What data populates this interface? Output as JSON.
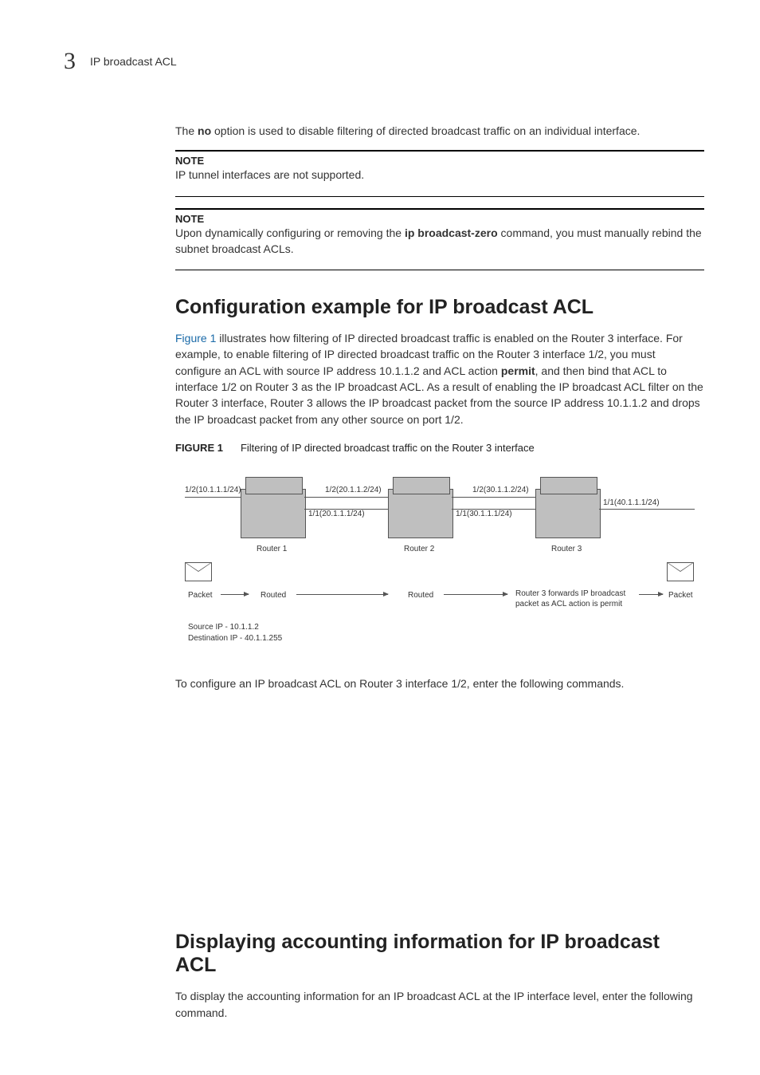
{
  "header": {
    "chapter_number": "3",
    "chapter_title": "IP broadcast ACL"
  },
  "intro": {
    "text_before": "The ",
    "bold_cmd": "no",
    "text_after": " option is used to disable filtering of directed broadcast traffic on an individual interface."
  },
  "note1": {
    "label": "NOTE",
    "text": "IP tunnel interfaces are not supported."
  },
  "note2": {
    "label": "NOTE",
    "text_before": "Upon dynamically configuring or removing the ",
    "bold_cmd": "ip broadcast-zero",
    "text_after": " command, you must manually rebind the subnet broadcast ACLs."
  },
  "section1": {
    "heading": "Configuration example for IP broadcast ACL",
    "para": {
      "link": "Figure 1",
      "text_mid1": " illustrates how filtering of IP directed broadcast traffic is enabled on the Router 3 interface. For example, to enable filtering of IP directed broadcast traffic on the Router 3 interface 1/2, you must configure an ACL with source IP address 10.1.1.2 and ACL action ",
      "bold_cmd": "permit",
      "text_mid2": ", and then bind that ACL to interface 1/2 on Router 3 as the IP broadcast ACL. As a result of enabling the IP broadcast ACL filter on the Router 3 interface, Router 3 allows the IP broadcast packet from the source IP address 10.1.1.2 and drops the IP broadcast packet from any other source on port 1/2."
    },
    "figure": {
      "label": "FIGURE 1",
      "caption": "Filtering of IP directed broadcast traffic on the Router 3 interface",
      "routers": [
        "Router 1",
        "Router 2",
        "Router 3"
      ],
      "ports": {
        "r1_left": "1/2(10.1.1.1/24)",
        "r1_right_top": "1/2(20.1.1.2/24)",
        "r1_right_bot": "1/1(20.1.1.1/24)",
        "r2_right_top": "1/2(30.1.1.2/24)",
        "r2_right_bot": "1/1(30.1.1.1/24)",
        "r3_right": "1/1(40.1.1.1/24)"
      },
      "flow": {
        "packet_left": "Packet",
        "routed1": "Routed",
        "routed2": "Routed",
        "forward_text": "Router 3 forwards IP broadcast\npacket as ACL action is permit",
        "packet_right": "Packet"
      },
      "source_dest": {
        "source": "Source IP - 10.1.1.2",
        "dest": "Destination IP - 40.1.1.255"
      }
    },
    "config_text": "To configure an IP broadcast ACL on Router 3 interface 1/2, enter the following commands."
  },
  "section2": {
    "heading": "Displaying accounting information for IP broadcast ACL",
    "para": "To display the accounting information for an IP broadcast ACL at the IP interface level, enter the following command."
  }
}
